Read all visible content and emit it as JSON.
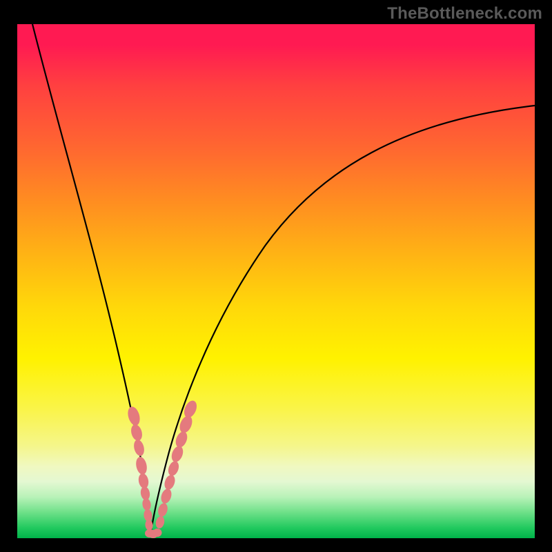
{
  "watermark": "TheBottleneck.com",
  "colors": {
    "bead": "#e47a7e",
    "curve": "#000000",
    "frame_bg_top": "#ff1a52",
    "frame_bg_bottom": "#00b34a",
    "page_bg": "#000000"
  },
  "chart_data": {
    "type": "line",
    "title": "",
    "xlabel": "",
    "ylabel": "",
    "xlim": [
      0,
      100
    ],
    "ylim": [
      0,
      100
    ],
    "series": [
      {
        "name": "left-curve",
        "x": [
          3,
          8,
          12,
          15,
          18,
          20,
          22,
          23.5,
          24.5,
          25.2,
          25.7
        ],
        "y": [
          100,
          80,
          62,
          48,
          36,
          26,
          18,
          11,
          6,
          2,
          0
        ]
      },
      {
        "name": "right-curve",
        "x": [
          25.7,
          26.7,
          28.5,
          31,
          35,
          42,
          52,
          65,
          80,
          95,
          100
        ],
        "y": [
          0,
          3,
          8,
          15,
          25,
          40,
          55,
          67,
          76,
          82,
          84
        ]
      }
    ],
    "beads": {
      "left": [
        {
          "x": 22.5,
          "y": 22
        },
        {
          "x": 22.9,
          "y": 19
        },
        {
          "x": 23.3,
          "y": 16.5
        },
        {
          "x": 23.8,
          "y": 13
        },
        {
          "x": 24.2,
          "y": 10.5
        },
        {
          "x": 24.5,
          "y": 8.5
        },
        {
          "x": 24.8,
          "y": 6.5
        },
        {
          "x": 25.1,
          "y": 4.5
        },
        {
          "x": 25.4,
          "y": 2.5
        }
      ],
      "bottom": [
        {
          "x": 25.7,
          "y": 0.8
        },
        {
          "x": 26.2,
          "y": 0.8
        },
        {
          "x": 26.7,
          "y": 0.8
        }
      ],
      "right": [
        {
          "x": 27.2,
          "y": 3
        },
        {
          "x": 27.8,
          "y": 6
        },
        {
          "x": 28.4,
          "y": 9
        },
        {
          "x": 29.0,
          "y": 12
        },
        {
          "x": 29.6,
          "y": 14.5
        },
        {
          "x": 30.3,
          "y": 17.5
        },
        {
          "x": 31.0,
          "y": 20
        },
        {
          "x": 31.8,
          "y": 22.5
        },
        {
          "x": 32.6,
          "y": 25
        }
      ]
    }
  }
}
